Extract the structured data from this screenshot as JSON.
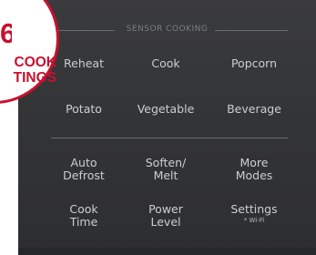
{
  "badge": {
    "number": "6",
    "line1": "COOK",
    "line2": "TINGS"
  },
  "panel": {
    "section_label": "SENSOR COOKING",
    "row1": {
      "reheat": "Reheat",
      "cook": "Cook",
      "popcorn": "Popcorn"
    },
    "row2": {
      "potato": "Potato",
      "vegetable": "Vegetable",
      "beverage": "Beverage"
    },
    "row3": {
      "auto_defrost": {
        "line1": "Auto",
        "line2": "Defrost"
      },
      "soften_melt": {
        "line1": "Soften/",
        "line2": "Melt"
      },
      "more_modes": {
        "line1": "More",
        "line2": "Modes"
      }
    },
    "row4": {
      "cook_time": {
        "line1": "Cook",
        "line2": "Time"
      },
      "power_level": {
        "line1": "Power",
        "line2": "Level"
      },
      "settings": {
        "line1": "Settings",
        "sub": "* Wi-Fi"
      }
    }
  },
  "colors": {
    "panel": "#343537",
    "key_text": "#cdcecf",
    "divider": "#6b6c6e",
    "badge_red": "#c8102e",
    "badge_bg": "#ffffff"
  }
}
